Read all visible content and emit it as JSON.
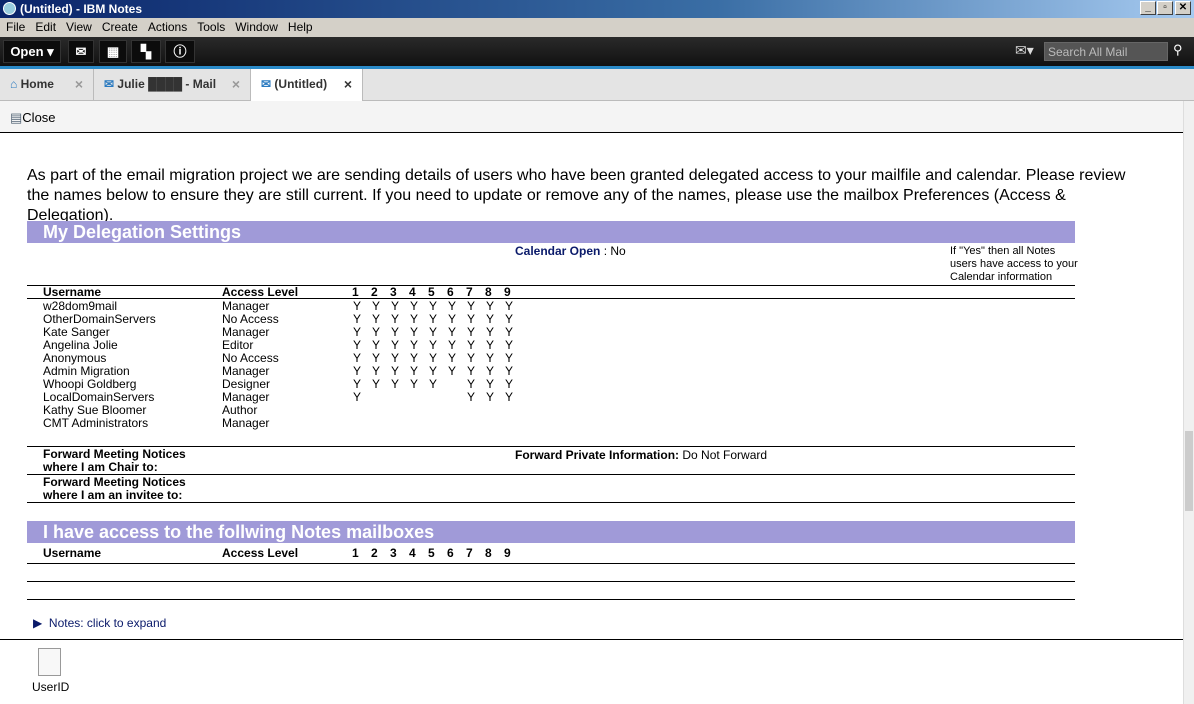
{
  "window": {
    "title": "(Untitled) - IBM Notes",
    "min": "_",
    "max": "▫",
    "close": "✕"
  },
  "menu": [
    "File",
    "Edit",
    "View",
    "Create",
    "Actions",
    "Tools",
    "Window",
    "Help"
  ],
  "toolbar": {
    "open": "Open ▾",
    "search_placeholder": "Search All Mail"
  },
  "tabs": [
    {
      "label": "Home"
    },
    {
      "label": "Julie ████ - Mail"
    },
    {
      "label": "(Untitled)"
    }
  ],
  "action": {
    "close": "Close"
  },
  "intro": "As part of the email migration project we are sending details of users who have been granted delegated access to your mailfile and calendar. Please review the names below to ensure they are still current. If you need to update or remove any of the names, please use the mailbox Preferences (Access & Delegation).",
  "section1": {
    "title": "My Delegation Settings",
    "calendar_label": "Calendar Open",
    "calendar_value": ": No",
    "note": "If \"Yes\" then all Notes users have access to your Calendar information",
    "headers": {
      "username": "Username",
      "access": "Access Level",
      "cols": [
        "1",
        "2",
        "3",
        "4",
        "5",
        "6",
        "7",
        "8",
        "9"
      ]
    },
    "rows": [
      {
        "user": "w28dom9mail",
        "access": "Manager",
        "flags": [
          "Y",
          "Y",
          "Y",
          "Y",
          "Y",
          "Y",
          "Y",
          "Y",
          "Y"
        ]
      },
      {
        "user": "OtherDomainServers",
        "access": "No Access",
        "flags": [
          "Y",
          "Y",
          "Y",
          "Y",
          "Y",
          "Y",
          "Y",
          "Y",
          "Y"
        ]
      },
      {
        "user": "Kate Sanger",
        "access": "Manager",
        "flags": [
          "Y",
          "Y",
          "Y",
          "Y",
          "Y",
          "Y",
          "Y",
          "Y",
          "Y"
        ]
      },
      {
        "user": "Angelina Jolie",
        "access": "Editor",
        "flags": [
          "Y",
          "Y",
          "Y",
          "Y",
          "Y",
          "Y",
          "Y",
          "Y",
          "Y"
        ]
      },
      {
        "user": "Anonymous",
        "access": "No Access",
        "flags": [
          "Y",
          "Y",
          "Y",
          "Y",
          "Y",
          "Y",
          "Y",
          "Y",
          "Y"
        ]
      },
      {
        "user": "Admin Migration",
        "access": "Manager",
        "flags": [
          "Y",
          "Y",
          "Y",
          "Y",
          "Y",
          "Y",
          "Y",
          "Y",
          "Y"
        ]
      },
      {
        "user": "Whoopi Goldberg",
        "access": "Designer",
        "flags": [
          "Y",
          "Y",
          "Y",
          "Y",
          "Y",
          "",
          "Y",
          "Y",
          "Y"
        ]
      },
      {
        "user": "LocalDomainServers",
        "access": "Manager",
        "flags": [
          "Y",
          "",
          "",
          "",
          "",
          "",
          "Y",
          "Y",
          "Y"
        ]
      },
      {
        "user": "Kathy Sue Bloomer",
        "access": "Author",
        "flags": [
          "",
          "",
          "",
          "",
          "",
          "",
          "",
          "",
          ""
        ]
      },
      {
        "user": "CMT Administrators",
        "access": "Manager",
        "flags": [
          "",
          "",
          "",
          "",
          "",
          "",
          "",
          "",
          ""
        ]
      }
    ],
    "fwd_chair": "Forward Meeting Notices where I am Chair to:",
    "fwd_invitee": "Forward Meeting Notices where I am an invitee to:",
    "fwd_private_label": "Forward Private Information:",
    "fwd_private_value": "Do Not Forward"
  },
  "section2": {
    "title": "I have access to the follwing Notes mailboxes"
  },
  "notes_expand": "Notes: click to expand",
  "attachment": "UserID"
}
